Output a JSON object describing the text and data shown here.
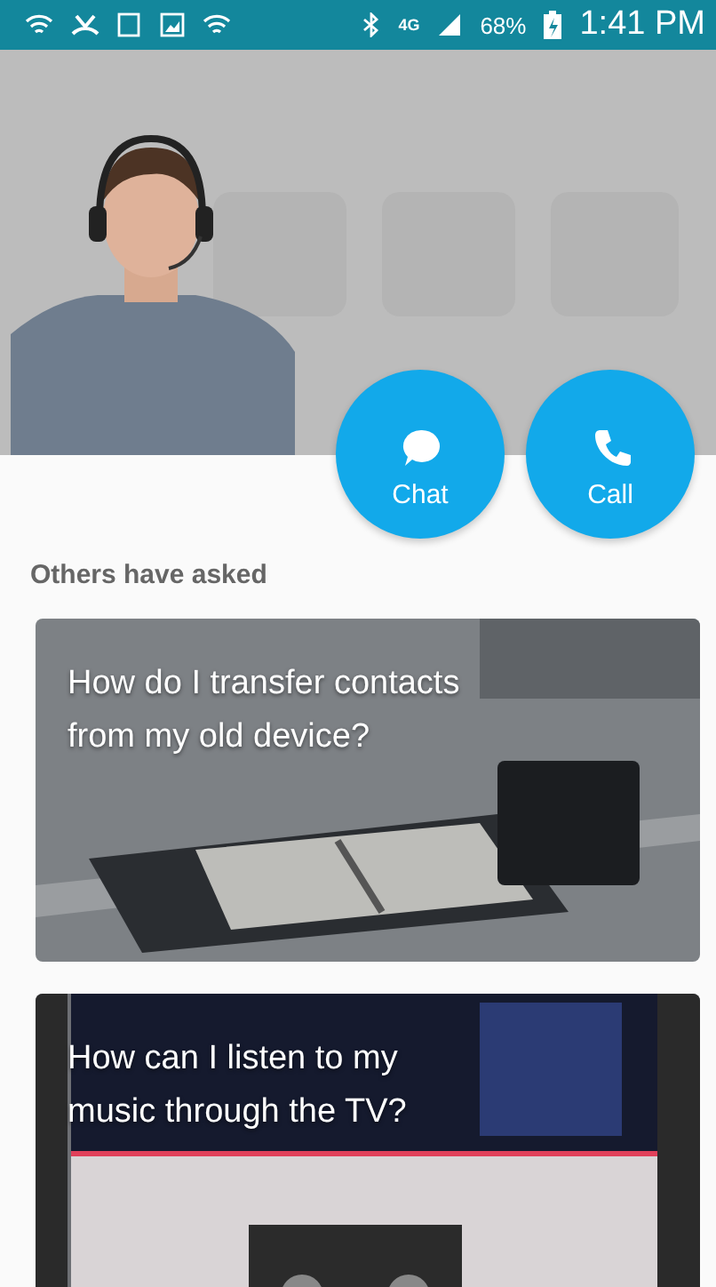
{
  "status_bar": {
    "network": "4G",
    "battery": "68%",
    "time": "1:41 PM"
  },
  "actions": [
    {
      "kind": "chat",
      "label": "Chat"
    },
    {
      "kind": "call",
      "label": "Call"
    }
  ],
  "section_title": "Others have asked",
  "questions": [
    {
      "text": "How do I transfer contacts from my old device?",
      "kind": "picture"
    },
    {
      "text": "How can I listen to my music through the TV?",
      "kind": "picture"
    }
  ]
}
